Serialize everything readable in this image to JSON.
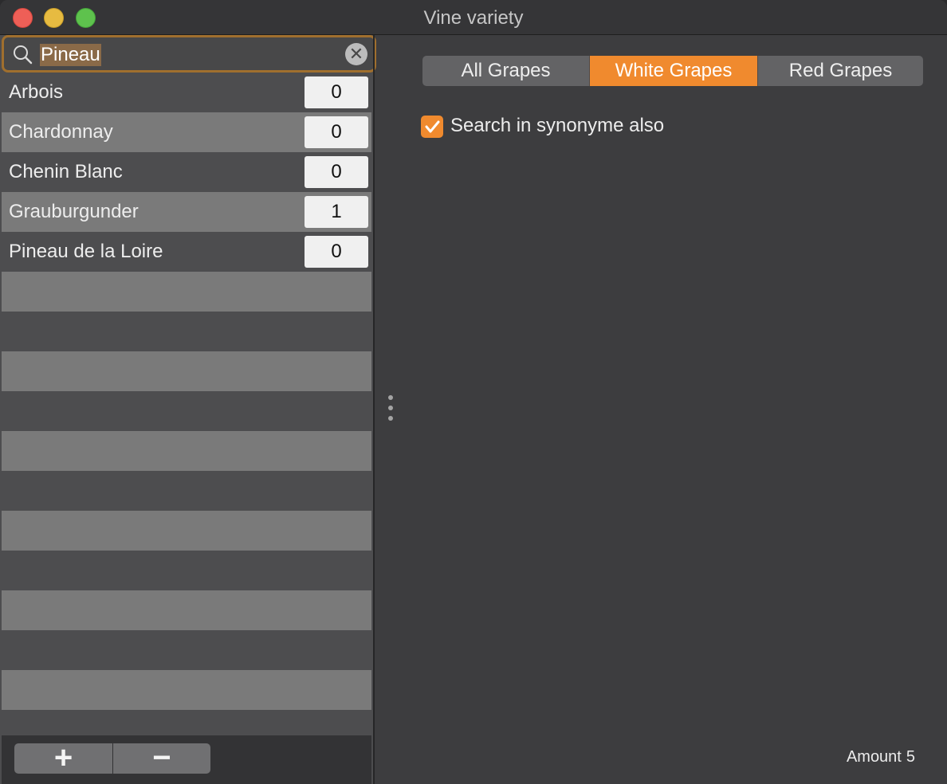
{
  "window": {
    "title": "Vine variety"
  },
  "search": {
    "value": "Pineau"
  },
  "list": {
    "items": [
      {
        "name": "Arbois",
        "count": "0"
      },
      {
        "name": "Chardonnay",
        "count": "0"
      },
      {
        "name": "Chenin Blanc",
        "count": "0"
      },
      {
        "name": "Grauburgunder",
        "count": "1"
      },
      {
        "name": "Pineau de la Loire",
        "count": "0"
      }
    ]
  },
  "toolbar": {
    "add_label": "+",
    "remove_label": "−"
  },
  "filter": {
    "tabs": [
      "All Grapes",
      "White Grapes",
      "Red Grapes"
    ],
    "selected": "White Grapes"
  },
  "options": {
    "synonym_label": "Search in synonyme also",
    "synonym_checked": true
  },
  "status": {
    "amount_label": "Amount",
    "amount_value": "5"
  },
  "colors": {
    "accent": "#f08a2e",
    "focus_ring": "#a06f2e"
  },
  "icons": {
    "search": "search-icon",
    "clear": "clear-icon",
    "check": "check-icon",
    "grip": "splitter-grip-icon"
  }
}
